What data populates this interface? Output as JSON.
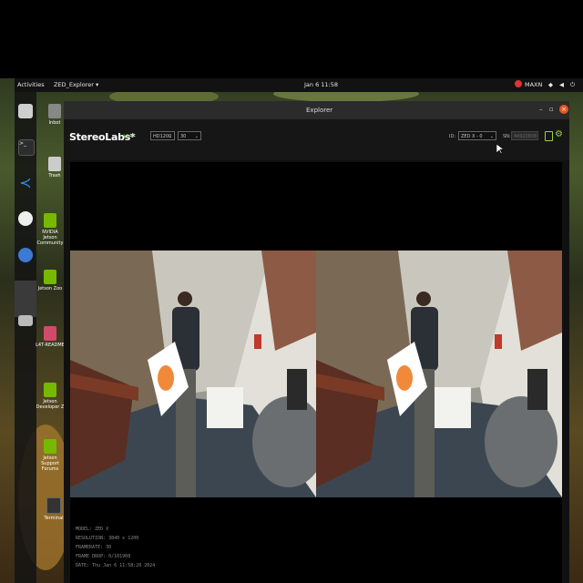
{
  "topbar": {
    "activities": "Activities",
    "app_menu": "ZED_Explorer ▾",
    "clock": "Jan 6 11:58",
    "power_mode": "MAXN"
  },
  "desktop_icons": [
    {
      "label": "Inbot"
    },
    {
      "label": "Trash"
    },
    {
      "label": "NVIDIA Jetson Community"
    },
    {
      "label": "Jetson Zoo"
    },
    {
      "label": "L4T-README"
    },
    {
      "label": "Jetson Developer Z"
    },
    {
      "label": "Jetson Support Forums"
    },
    {
      "label": "Terminal"
    }
  ],
  "window": {
    "title": "Explorer",
    "brand": "StereoLabs*",
    "live_badge": "LIVE",
    "resolution_select": "HD1200",
    "fps_select": "30",
    "id_label": "ID:",
    "camera_select": "ZED X - 0",
    "sn_label": "SN:",
    "serial_value": "44920806"
  },
  "info": {
    "lines": [
      "MODEL: ZED X",
      "RESOLUTION: 3840 x 1200",
      "FRAMERATE: 30",
      "FRAME DROP: 0/101908",
      "DATE: Thu Jan 6 11:58:20 2024"
    ]
  }
}
